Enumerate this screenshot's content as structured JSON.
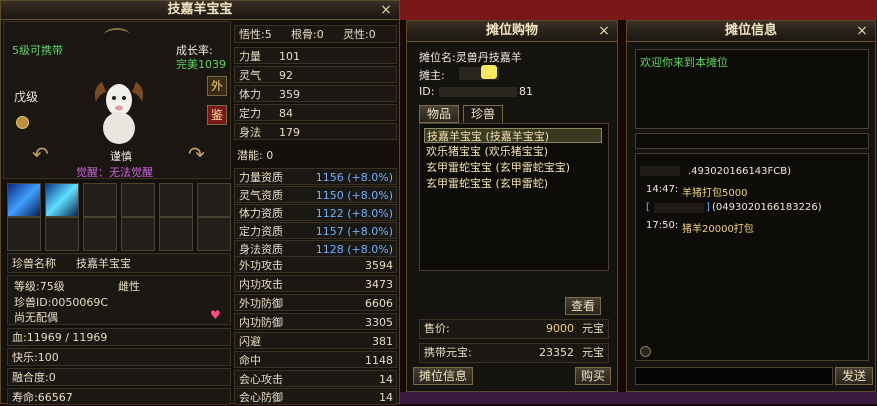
{
  "pet_window": {
    "title": "技嘉羊宝宝",
    "close": "×",
    "level_carry": "5级可携带",
    "growth_label": "成长率:",
    "growth_value": "完美1039",
    "grade": "戊级",
    "btn_outer": "外",
    "btn_appraise": "鉴",
    "pet_caption": "谨慎",
    "awaken": "觉醒：无法觉醒",
    "stats": [
      {
        "label": "悟性:5"
      },
      {
        "label": "根骨:0"
      },
      {
        "label": "灵性:0"
      }
    ],
    "attributes": [
      {
        "label": "力量",
        "value": "101"
      },
      {
        "label": "灵气",
        "value": "92"
      },
      {
        "label": "体力",
        "value": "359"
      },
      {
        "label": "定力",
        "value": "84"
      },
      {
        "label": "身法",
        "value": "179"
      }
    ],
    "potential": "潜能:  0",
    "aptitudes": [
      {
        "label": "力量资质",
        "value": "1156 (+8.0%)"
      },
      {
        "label": "灵气资质",
        "value": "1150 (+8.0%)"
      },
      {
        "label": "体力资质",
        "value": "1122 (+8.0%)"
      },
      {
        "label": "定力资质",
        "value": "1157 (+8.0%)"
      },
      {
        "label": "身法资质",
        "value": "1128 (+8.0%)"
      }
    ],
    "name_label": "珍兽名称",
    "name_value": "技嘉羊宝宝",
    "level": "等级:75级",
    "gender": "雌性",
    "pet_id": "珍兽ID:0050069C",
    "spouse": "尚无配偶",
    "hp": "血:11969 / 11969",
    "happy": "快乐:100",
    "fusion": "融合度:0",
    "lifespan": "寿命:66567",
    "combat": [
      {
        "label": "外功攻击",
        "value": "3594"
      },
      {
        "label": "内功攻击",
        "value": "3473"
      },
      {
        "label": "外功防御",
        "value": "6606"
      },
      {
        "label": "内功防御",
        "value": "3305"
      },
      {
        "label": "闪避",
        "value": "381"
      },
      {
        "label": "命中",
        "value": "1148"
      },
      {
        "label": "会心攻击",
        "value": "14"
      },
      {
        "label": "会心防御",
        "value": "14"
      }
    ]
  },
  "stall_buy": {
    "title": "摊位购物",
    "close": "×",
    "stall_name": "摊位名:灵兽丹技嘉羊",
    "owner": "摊主:",
    "id_prefix": "ID:",
    "id_suffix": "81",
    "tabs": [
      "物品",
      "珍兽"
    ],
    "items": [
      "技嘉羊宝宝 (技嘉羊宝宝)",
      "欢乐猪宝宝 (欢乐猪宝宝)",
      "玄甲雷蛇宝宝 (玄甲雷蛇宝宝)",
      "玄甲雷蛇宝宝 (玄甲雷蛇)"
    ],
    "view_btn": "查看",
    "price_label": "售价:",
    "price_value": "9000",
    "price_unit": "元宝",
    "carry_label": "携带元宝:",
    "carry_value": "23352",
    "carry_unit": "元宝",
    "info_btn": "摊位信息",
    "buy_btn": "购买"
  },
  "stall_info": {
    "title": "摊位信息",
    "close": "×",
    "welcome": "欢迎你来到本摊位",
    "messages": [
      {
        "text": ".493020166143FCB)"
      },
      {
        "time": "14:47:",
        "text": "羊猪打包5000"
      },
      {
        "bracket_l": "[",
        "bracket_r": "]",
        "text": "(0493020166183226)"
      },
      {
        "time": "17:50:",
        "text": "猪羊20000打包"
      }
    ],
    "send_btn": "发送"
  },
  "colors": {
    "gold": "#f2d27a",
    "green": "#5fd35f",
    "blue": "#6db2ff",
    "frame": "#5a4a2a"
  }
}
